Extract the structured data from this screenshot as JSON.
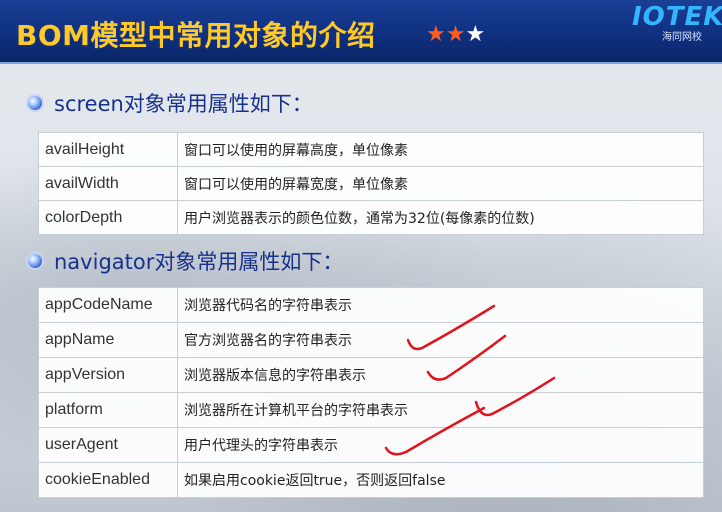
{
  "header": {
    "title": "BOM模型中常用对象的介绍",
    "stars_filled": "★★",
    "stars_empty": "★",
    "logo_text": "IOTEK",
    "logo_sub": "海同网校"
  },
  "screen_section": {
    "heading": "screen对象常用属性如下：",
    "rows": [
      {
        "name": "availHeight",
        "desc": "窗口可以使用的屏幕高度，单位像素"
      },
      {
        "name": "availWidth",
        "desc": "窗口可以使用的屏幕宽度，单位像素"
      },
      {
        "name": "colorDepth",
        "desc": "用户浏览器表示的颜色位数，通常为32位(每像素的位数)"
      }
    ]
  },
  "navigator_section": {
    "heading": "navigator对象常用属性如下：",
    "rows": [
      {
        "name": "appCodeName",
        "desc": "浏览器代码名的字符串表示"
      },
      {
        "name": "appName",
        "desc": "官方浏览器名的字符串表示"
      },
      {
        "name": "appVersion",
        "desc": "浏览器版本信息的字符串表示"
      },
      {
        "name": "platform",
        "desc": "浏览器所在计算机平台的字符串表示"
      },
      {
        "name": "userAgent",
        "desc": "用户代理头的字符串表示"
      },
      {
        "name": "cookieEnabled",
        "desc": "如果启用cookie返回true，否则返回false"
      }
    ]
  },
  "colors": {
    "header_bg": "#0f2f7f",
    "title": "#ffc928",
    "heading": "#18318c",
    "annotation": "#e0141e"
  }
}
